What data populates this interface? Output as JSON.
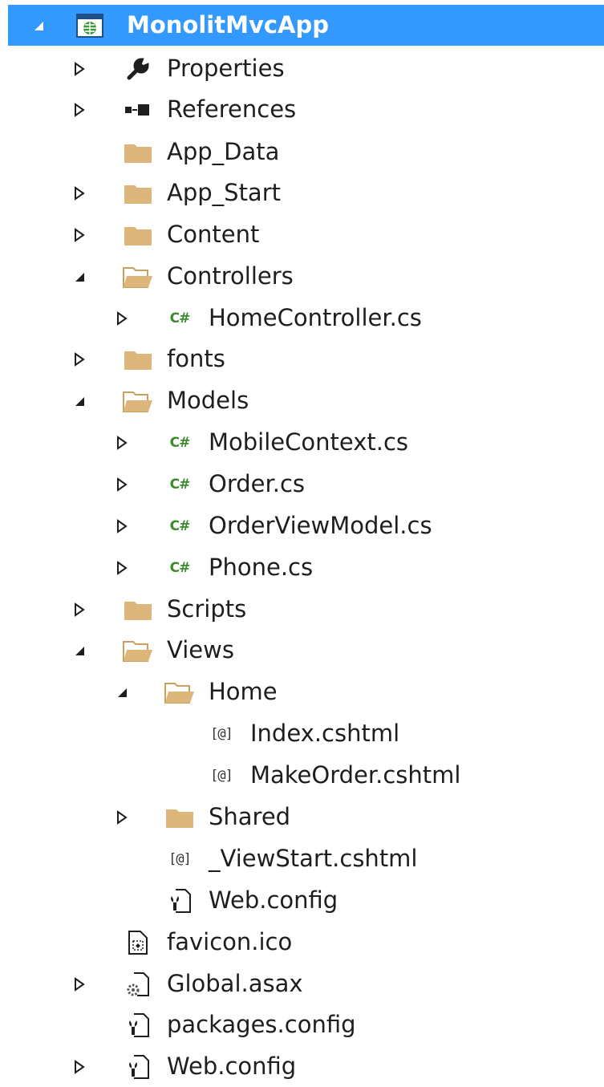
{
  "solution_explorer": {
    "project": {
      "label": "MonolitMvcApp",
      "icon": "web-project-icon",
      "expander": "expanded"
    },
    "items": [
      {
        "label": "Properties",
        "icon": "wrench-icon",
        "expander": "collapsed"
      },
      {
        "label": "References",
        "icon": "references-icon",
        "expander": "collapsed"
      },
      {
        "label": "App_Data",
        "icon": "folder-icon",
        "expander": "none"
      },
      {
        "label": "App_Start",
        "icon": "folder-icon",
        "expander": "collapsed"
      },
      {
        "label": "Content",
        "icon": "folder-icon",
        "expander": "collapsed"
      },
      {
        "label": "Controllers",
        "icon": "folder-open-icon",
        "expander": "expanded"
      },
      {
        "label": "HomeController.cs",
        "icon": "csharp-file-icon",
        "expander": "collapsed"
      },
      {
        "label": "fonts",
        "icon": "folder-icon",
        "expander": "collapsed"
      },
      {
        "label": "Models",
        "icon": "folder-open-icon",
        "expander": "expanded"
      },
      {
        "label": "MobileContext.cs",
        "icon": "csharp-file-icon",
        "expander": "collapsed"
      },
      {
        "label": "Order.cs",
        "icon": "csharp-file-icon",
        "expander": "collapsed"
      },
      {
        "label": "OrderViewModel.cs",
        "icon": "csharp-file-icon",
        "expander": "collapsed"
      },
      {
        "label": "Phone.cs",
        "icon": "csharp-file-icon",
        "expander": "collapsed"
      },
      {
        "label": "Scripts",
        "icon": "folder-icon",
        "expander": "collapsed"
      },
      {
        "label": "Views",
        "icon": "folder-open-icon",
        "expander": "expanded"
      },
      {
        "label": "Home",
        "icon": "folder-open-icon",
        "expander": "expanded"
      },
      {
        "label": "Index.cshtml",
        "icon": "razor-file-icon",
        "expander": "none"
      },
      {
        "label": "MakeOrder.cshtml",
        "icon": "razor-file-icon",
        "expander": "none"
      },
      {
        "label": "Shared",
        "icon": "folder-icon",
        "expander": "collapsed"
      },
      {
        "label": "_ViewStart.cshtml",
        "icon": "razor-file-icon",
        "expander": "none"
      },
      {
        "label": "Web.config",
        "icon": "config-file-icon",
        "expander": "none"
      },
      {
        "label": "favicon.ico",
        "icon": "ico-file-icon",
        "expander": "none"
      },
      {
        "label": "Global.asax",
        "icon": "asax-file-icon",
        "expander": "collapsed"
      },
      {
        "label": "packages.config",
        "icon": "config-file-icon",
        "expander": "none"
      },
      {
        "label": "Web.config",
        "icon": "config-file-icon",
        "expander": "collapsed"
      }
    ],
    "glyphs": {
      "csharp": "C#",
      "razor": "[@]"
    },
    "colors": {
      "selection": "#3399ff",
      "folder": "#dcb67a",
      "csharp": "#3c8a2e"
    }
  }
}
